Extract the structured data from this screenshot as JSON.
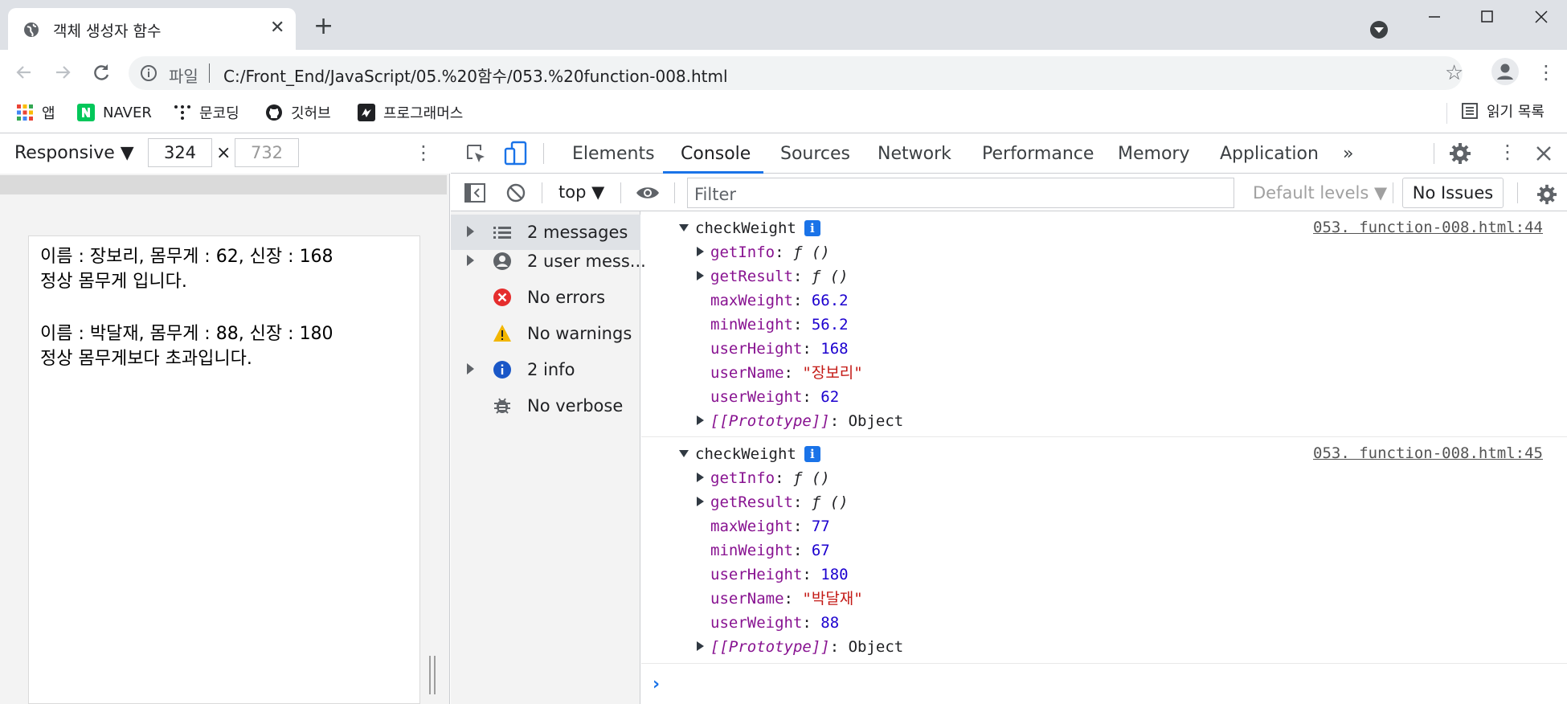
{
  "tab": {
    "title": "객체 생성자 함수",
    "close": "✕",
    "new_tab": "+"
  },
  "toolbar": {
    "scheme": "파일",
    "url": "C:/Front_End/JavaScript/05.%20함수/053.%20function-008.html"
  },
  "bookmarks": {
    "items": [
      {
        "label": "앱",
        "icon": "apps-grid-icon"
      },
      {
        "label": "NAVER",
        "icon": "naver-icon"
      },
      {
        "label": "문코딩",
        "icon": "moon-coding-icon"
      },
      {
        "label": "깃허브",
        "icon": "github-icon"
      },
      {
        "label": "프로그래머스",
        "icon": "programmers-icon"
      }
    ],
    "reading_list": "읽기 목록"
  },
  "device": {
    "mode": "Responsive ▼",
    "width": "324",
    "height": "732",
    "times": "×"
  },
  "page": {
    "lines": [
      "이름 : 장보리, 몸무게 : 62, 신장 : 168",
      "정상 몸무게 입니다.",
      "이름 : 박달재, 몸무게 : 88, 신장 : 180",
      "정상 몸무게보다 초과입니다."
    ]
  },
  "devtools": {
    "tabs": [
      "Elements",
      "Console",
      "Sources",
      "Network",
      "Performance",
      "Memory",
      "Application"
    ],
    "more": "»",
    "active_tab": "Console",
    "context": "top ▼",
    "filter_placeholder": "Filter",
    "levels": "Default levels ▼",
    "issues": "No Issues"
  },
  "sidebar": [
    {
      "label": "2 messages",
      "icon": "list-icon",
      "expandable": true
    },
    {
      "label": "2 user mess...",
      "icon": "user-icon",
      "expandable": true
    },
    {
      "label": "No errors",
      "icon": "error-icon",
      "expandable": false
    },
    {
      "label": "No warnings",
      "icon": "warning-icon",
      "expandable": false
    },
    {
      "label": "2 info",
      "icon": "info-icon",
      "expandable": true
    },
    {
      "label": "No verbose",
      "icon": "bug-icon",
      "expandable": false
    }
  ],
  "console": [
    {
      "name": "checkWeight",
      "source": "053. function-008.html:44",
      "props": [
        {
          "key": "getInfo",
          "value": "ƒ ()",
          "kind": "fn"
        },
        {
          "key": "getResult",
          "value": "ƒ ()",
          "kind": "fn"
        },
        {
          "key": "maxWeight",
          "value": "66.2",
          "kind": "num"
        },
        {
          "key": "minWeight",
          "value": "56.2",
          "kind": "num"
        },
        {
          "key": "userHeight",
          "value": "168",
          "kind": "num"
        },
        {
          "key": "userName",
          "value": "\"장보리\"",
          "kind": "str"
        },
        {
          "key": "userWeight",
          "value": "62",
          "kind": "num"
        },
        {
          "key": "[[Prototype]]",
          "value": "Object",
          "kind": "proto"
        }
      ]
    },
    {
      "name": "checkWeight",
      "source": "053. function-008.html:45",
      "props": [
        {
          "key": "getInfo",
          "value": "ƒ ()",
          "kind": "fn"
        },
        {
          "key": "getResult",
          "value": "ƒ ()",
          "kind": "fn"
        },
        {
          "key": "maxWeight",
          "value": "77",
          "kind": "num"
        },
        {
          "key": "minWeight",
          "value": "67",
          "kind": "num"
        },
        {
          "key": "userHeight",
          "value": "180",
          "kind": "num"
        },
        {
          "key": "userName",
          "value": "\"박달재\"",
          "kind": "str"
        },
        {
          "key": "userWeight",
          "value": "88",
          "kind": "num"
        },
        {
          "key": "[[Prototype]]",
          "value": "Object",
          "kind": "proto"
        }
      ]
    }
  ],
  "prompt": "›",
  "colors": {
    "accent": "#1a73e8",
    "key": "#881391",
    "number": "#1c00cf",
    "string": "#c41a16"
  }
}
